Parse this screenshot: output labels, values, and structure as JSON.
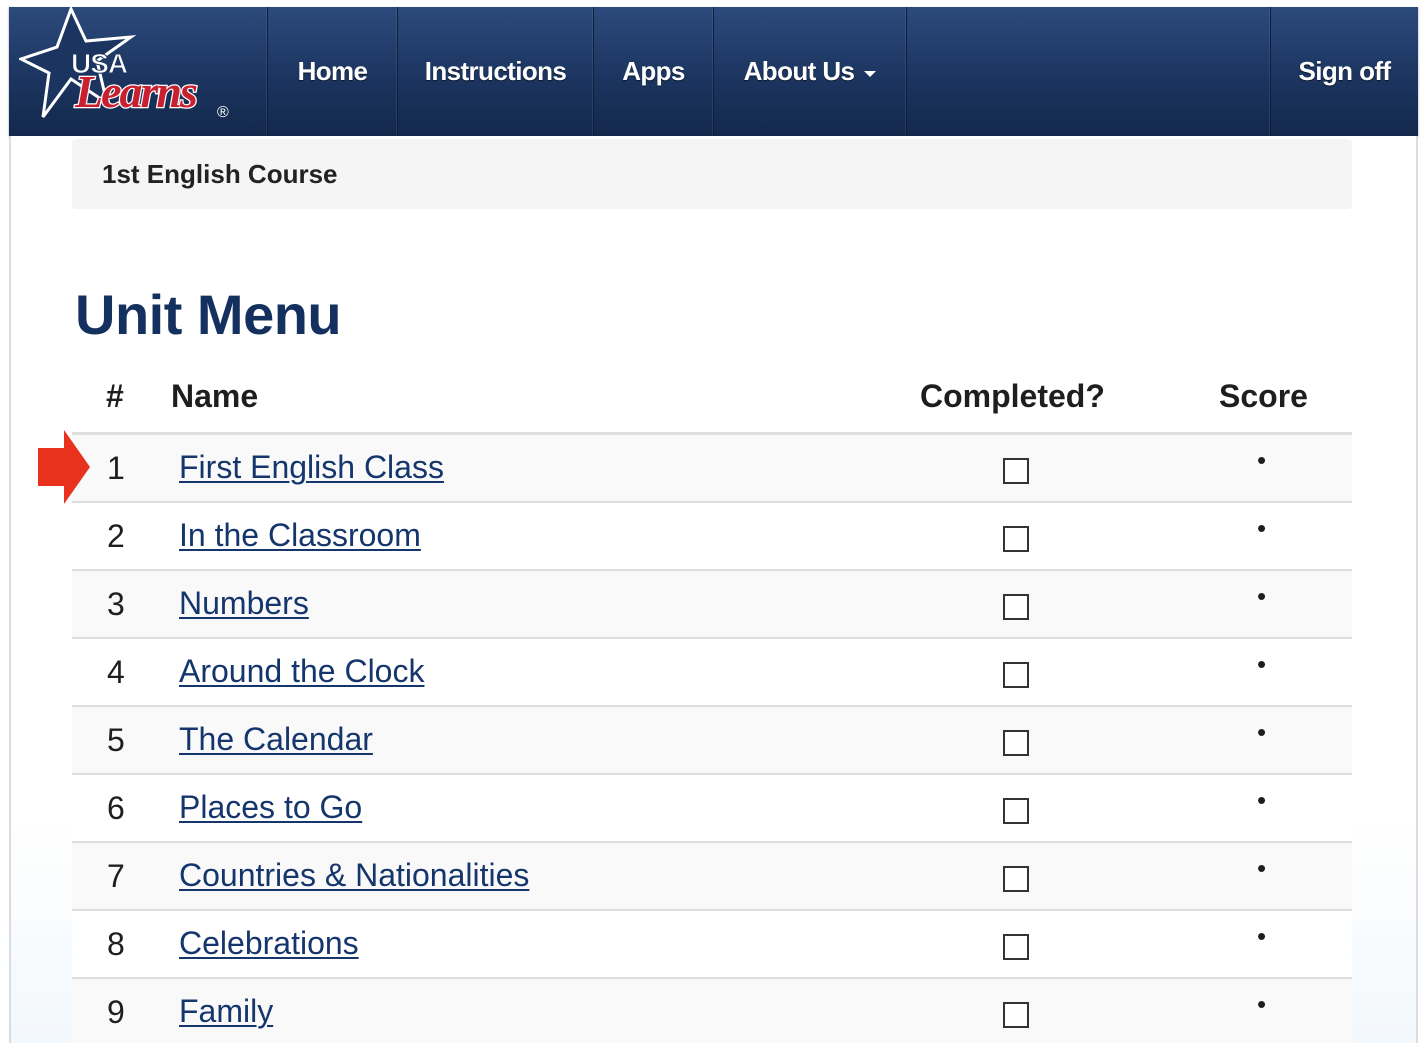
{
  "brand": {
    "logo_text_top": "USA",
    "logo_text_bottom": "Learns",
    "logo_mark": "®"
  },
  "nav": {
    "home": "Home",
    "instructions": "Instructions",
    "apps": "Apps",
    "about": "About Us",
    "sign_off": "Sign off"
  },
  "breadcrumb": "1st English Course",
  "page_title": "Unit Menu",
  "table": {
    "headers": {
      "num": "#",
      "name": "Name",
      "completed": "Completed?",
      "score": "Score"
    },
    "rows": [
      {
        "num": "1",
        "name": "First English Class",
        "completed": false,
        "score": "•"
      },
      {
        "num": "2",
        "name": "In the Classroom",
        "completed": false,
        "score": "•"
      },
      {
        "num": "3",
        "name": "Numbers",
        "completed": false,
        "score": "•"
      },
      {
        "num": "4",
        "name": "Around the Clock",
        "completed": false,
        "score": "•"
      },
      {
        "num": "5",
        "name": "The Calendar",
        "completed": false,
        "score": "•"
      },
      {
        "num": "6",
        "name": "Places to Go",
        "completed": false,
        "score": "•"
      },
      {
        "num": "7",
        "name": "Countries & Nationalities",
        "completed": false,
        "score": "•"
      },
      {
        "num": "8",
        "name": "Celebrations",
        "completed": false,
        "score": "•"
      },
      {
        "num": "9",
        "name": "Family",
        "completed": false,
        "score": "•"
      }
    ]
  },
  "icons": {
    "caret": "chevron-down-icon",
    "pointer": "red-arrow-icon",
    "logo": "star-logo"
  },
  "colors": {
    "navbar": "#1c3560",
    "title": "#14305e",
    "link": "#15366c",
    "arrow": "#e8321e"
  }
}
